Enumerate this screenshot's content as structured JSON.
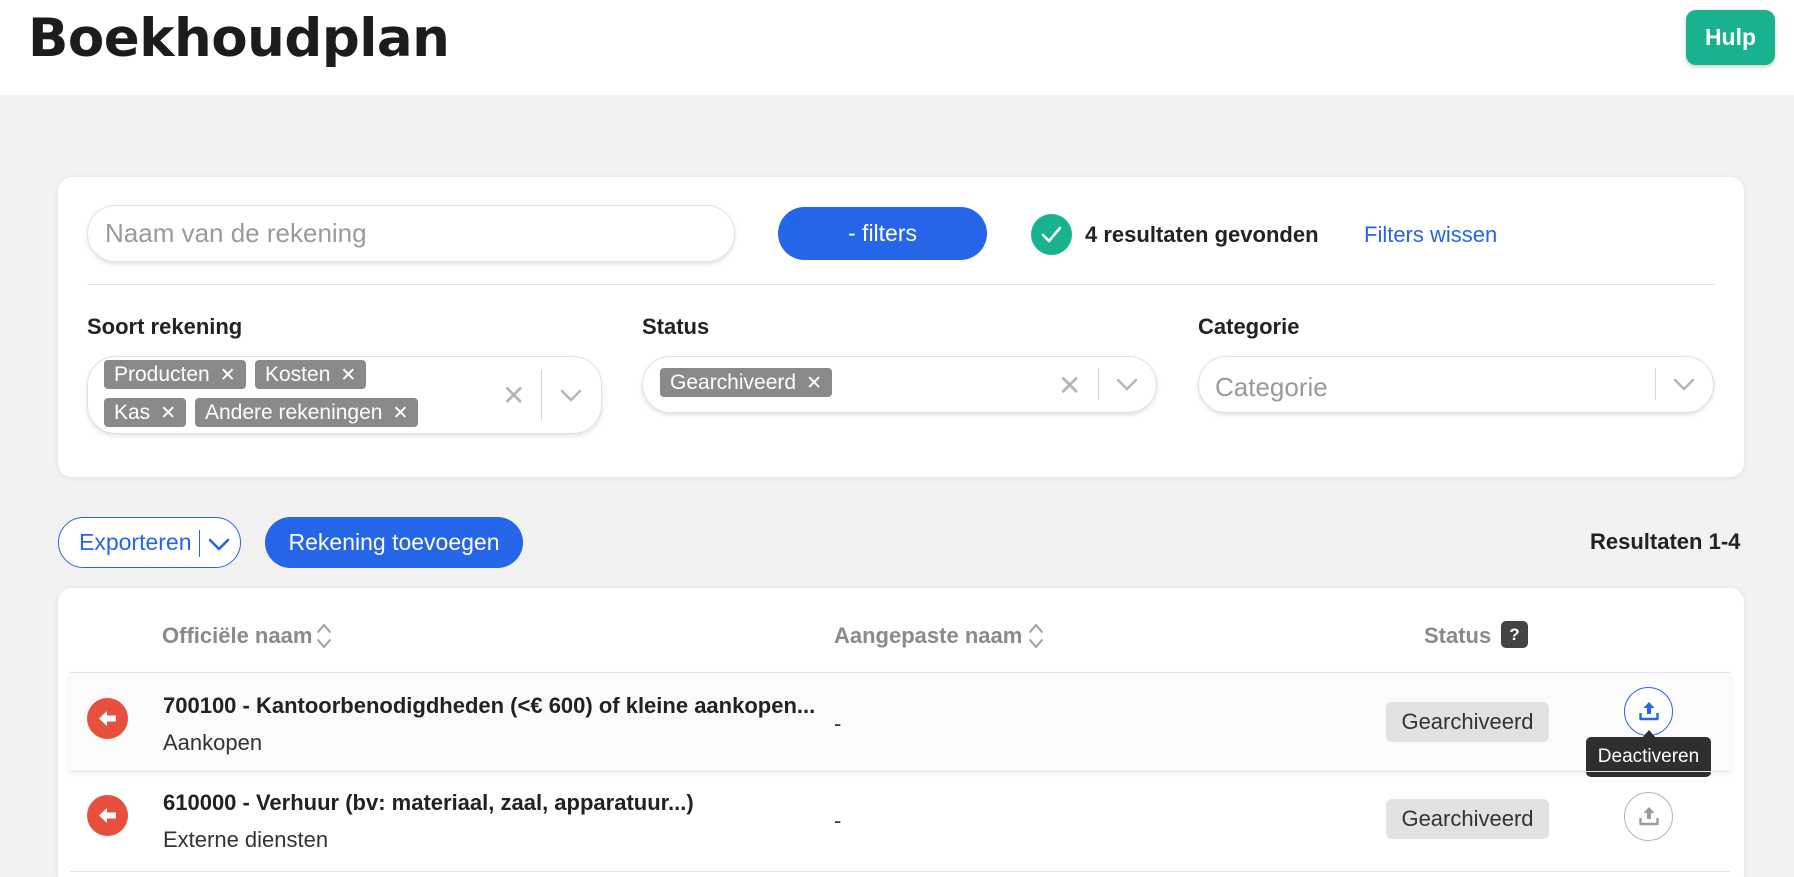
{
  "header": {
    "title": "Boekhoudplan",
    "help_label": "Hulp",
    "help_color": "#19b28e"
  },
  "filters": {
    "search_placeholder": "Naam van de rekening",
    "search_value": "",
    "toggle_label": "- filters",
    "results_found": "4 resultaten gevonden",
    "clear_label": "Filters wissen",
    "account_type": {
      "label": "Soort rekening",
      "chips": [
        "Producten",
        "Kosten",
        "Kas",
        "Andere rekeningen"
      ]
    },
    "status": {
      "label": "Status",
      "chips": [
        "Gearchiveerd"
      ]
    },
    "category": {
      "label": "Categorie",
      "placeholder": "Categorie"
    }
  },
  "actions": {
    "export_label": "Exporteren",
    "add_label": "Rekening toevoegen",
    "range_text": "Resultaten 1-4"
  },
  "table": {
    "columns": {
      "official_name": "Officiële naam",
      "custom_name": "Aangepaste naam",
      "status": "Status",
      "status_help": "?"
    },
    "rows": [
      {
        "name": "700100 - Kantoorbenodigdheden (<€ 600) of kleine aankopen...",
        "category": "Aankopen",
        "custom_name": "-",
        "status": "Gearchiveerd",
        "action_tooltip": "Deactiveren",
        "action_icon": "upload-icon"
      },
      {
        "name": "610000 - Verhuur (bv: materiaal, zaal, apparatuur...)",
        "category": "Externe diensten",
        "custom_name": "-",
        "status": "Gearchiveerd",
        "action_icon": "upload-icon"
      }
    ]
  },
  "colors": {
    "primary": "#2565e8",
    "success": "#19b28e",
    "danger": "#e8503e",
    "chip": "#8a8a8a"
  }
}
